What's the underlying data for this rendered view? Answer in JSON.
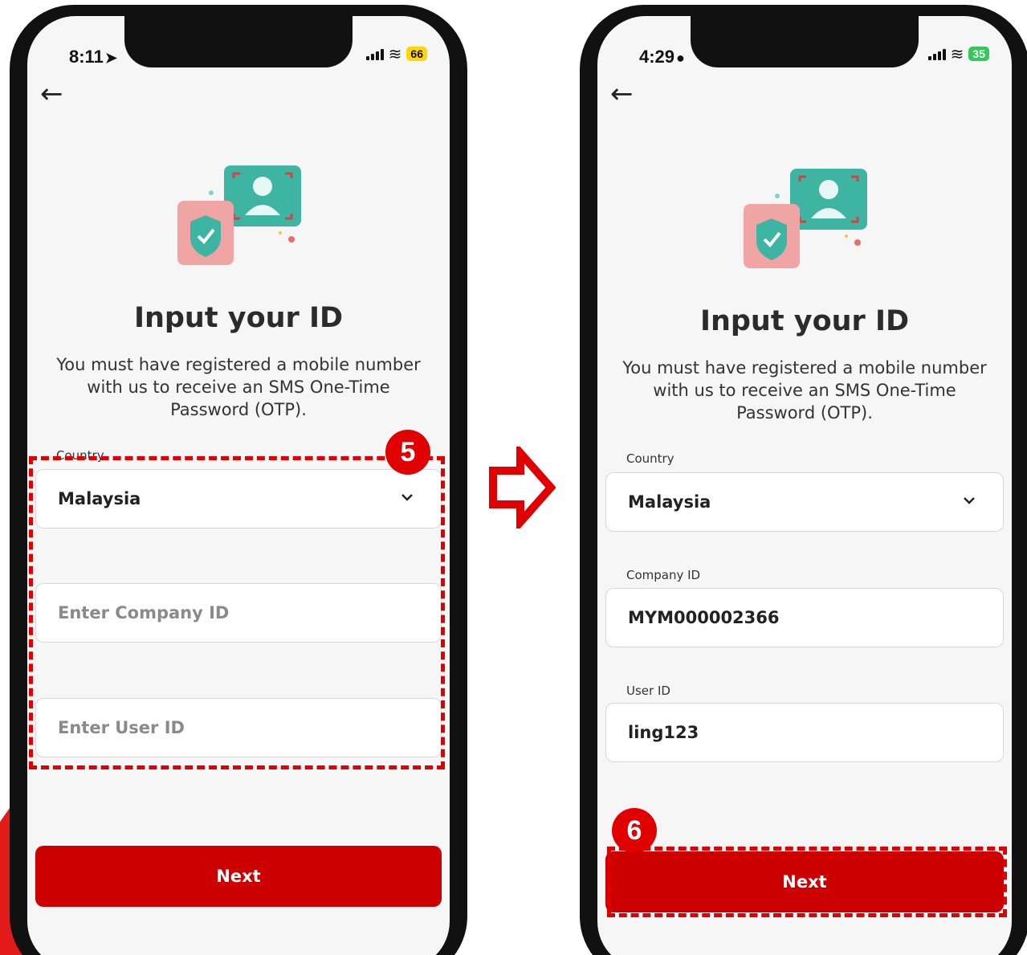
{
  "left_screen": {
    "status": {
      "time": "8:11",
      "battery": "66"
    },
    "title": "Input your ID",
    "description": "You must have registered a mobile number with us to receive an SMS One-Time Password (OTP).",
    "country_label": "Country",
    "country_value": "Malaysia",
    "company_placeholder": "Enter Company ID",
    "user_placeholder": "Enter User ID",
    "next_label": "Next",
    "step_badge": "5"
  },
  "right_screen": {
    "status": {
      "time": "4:29",
      "battery": "35"
    },
    "title": "Input your ID",
    "description": "You must have registered a mobile number with us to receive an SMS One-Time Password (OTP).",
    "country_label": "Country",
    "country_value": "Malaysia",
    "company_label": "Company ID",
    "company_value": "MYM000002366",
    "user_label": "User ID",
    "user_value": "ling123",
    "next_label": "Next",
    "step_badge": "6"
  },
  "colors": {
    "accent": "#cc0000",
    "annotation": "#e00000",
    "background": "#f6f6f6"
  },
  "icons": [
    "back-arrow-icon",
    "chevron-down-icon",
    "location-arrow-icon",
    "person-icon",
    "wifi-icon",
    "id-shield-illustration"
  ]
}
